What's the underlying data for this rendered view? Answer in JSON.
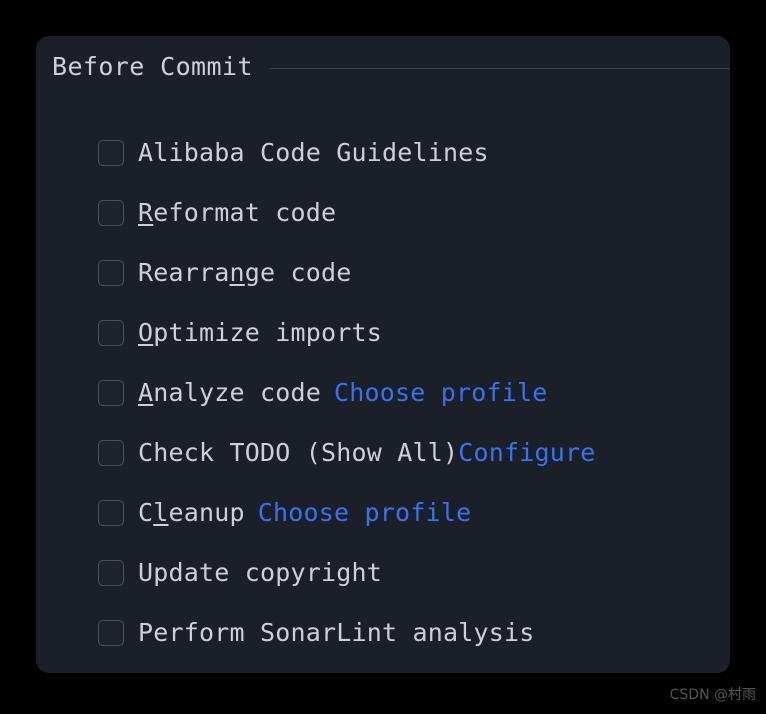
{
  "theme": {
    "outer_background": "#000000",
    "panel_background": "#1b1f28",
    "text_color": "#cdd0d6",
    "link_color": "#3574f0",
    "checkbox_border": "#4a4f5b",
    "rule_color": "#393d47",
    "watermark_color": "#545454"
  },
  "group": {
    "title": "Before Commit"
  },
  "rows": [
    {
      "name": "alibaba-code-guidelines",
      "pre": "",
      "mnemonic": "",
      "post": "Alibaba Code Guidelines",
      "checked": false,
      "link": ""
    },
    {
      "name": "reformat-code",
      "pre": "",
      "mnemonic": "R",
      "post": "eformat code",
      "checked": false,
      "link": ""
    },
    {
      "name": "rearrange-code",
      "pre": "Rearra",
      "mnemonic": "n",
      "post": "ge code",
      "checked": false,
      "link": ""
    },
    {
      "name": "optimize-imports",
      "pre": "",
      "mnemonic": "O",
      "post": "ptimize imports",
      "checked": false,
      "link": ""
    },
    {
      "name": "analyze-code",
      "pre": "",
      "mnemonic": "A",
      "post": "nalyze code",
      "checked": false,
      "link": "Choose profile"
    },
    {
      "name": "check-todo",
      "pre": "",
      "mnemonic": "",
      "post": "Check TODO (Show All)",
      "checked": false,
      "link": "Configure"
    },
    {
      "name": "cleanup",
      "pre": "C",
      "mnemonic": "l",
      "post": "eanup",
      "checked": false,
      "link": "Choose profile"
    },
    {
      "name": "update-copyright",
      "pre": "",
      "mnemonic": "",
      "post": "Update copyright",
      "checked": false,
      "link": ""
    },
    {
      "name": "perform-sonarlint-analysis",
      "pre": "",
      "mnemonic": "",
      "post": "Perform SonarLint analysis",
      "checked": false,
      "link": ""
    }
  ],
  "watermark": {
    "text": "CSDN @村雨"
  }
}
